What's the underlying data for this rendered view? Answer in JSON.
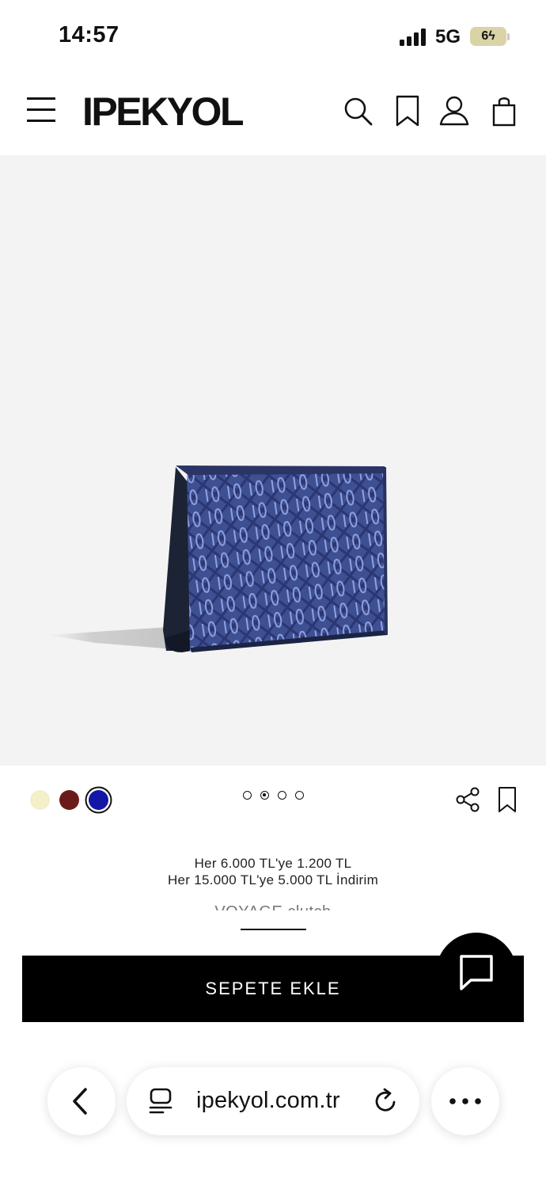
{
  "status_bar": {
    "time": "14:57",
    "network": "5G",
    "battery": "6ϟ"
  },
  "header": {
    "logo": "IPEKYOL",
    "icons": [
      "menu-icon",
      "search-icon",
      "bookmark-icon",
      "user-icon",
      "shopping-bag-icon"
    ]
  },
  "product": {
    "image_alt": "VOYAGE clutch",
    "swatches": [
      {
        "color": "#f2efc9",
        "selected": false
      },
      {
        "color": "#6b1a1a",
        "selected": false
      },
      {
        "color": "#1416a8",
        "selected": true
      }
    ],
    "gallery": {
      "total": 4,
      "active_index": 2
    },
    "promo_line_1": "Her 6.000 TL'ye 1.200 TL",
    "promo_line_2": "Her 15.000 TL'ye 5.000 TL İndirim",
    "name": "VOYAGE clutch",
    "add_to_cart_label": "SEPETE EKLE"
  },
  "browser": {
    "url": "ipekyol.com.tr",
    "icons": [
      "back-icon",
      "tabs-icon",
      "reload-icon",
      "more-icon"
    ]
  },
  "colors": {
    "accent": "#000000",
    "image_background": "#f3f3f3",
    "bag_pattern": "#3e4f92"
  }
}
